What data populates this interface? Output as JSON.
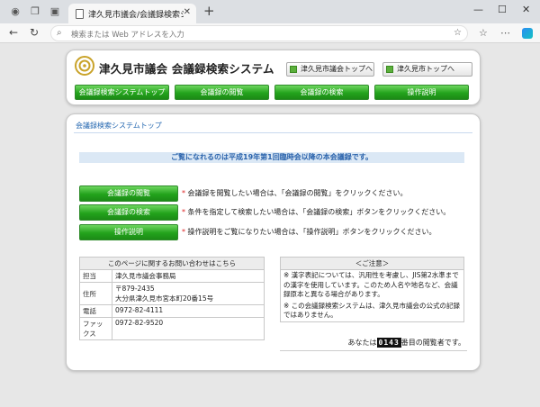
{
  "browser": {
    "tab_title": "津久見市議会/会議録検索システム",
    "address_placeholder": "検索または Web アドレスを入力"
  },
  "header": {
    "site_title": "津久見市議会 会議録検索システム",
    "links": [
      "津久見市議会トップへ",
      "津久見市トップへ"
    ],
    "nav": [
      "会議録検索システムトップ",
      "会議録の閲覧",
      "会議録の検索",
      "操作説明"
    ]
  },
  "main": {
    "section_title": "会議録検索システムトップ",
    "notice": "ご覧になれるのは平成19年第1回臨時会以降の本会議録です。",
    "actions": [
      {
        "label": "会議録の閲覧",
        "desc": "会議録を閲覧したい場合は、「会議録の閲覧」をクリックください。"
      },
      {
        "label": "会議録の検索",
        "desc": "条件を指定して検索したい場合は、「会議録の検索」ボタンをクリックください。"
      },
      {
        "label": "操作説明",
        "desc": "操作説明をご覧になりたい場合は、「操作説明」ボタンをクリックください。"
      }
    ],
    "asterisk": "*",
    "contact": {
      "heading": "このページに関するお問い合わせはこちら",
      "rows": [
        {
          "key": "担当",
          "value": "津久見市議会事務局"
        },
        {
          "key": "住所",
          "value": "〒879-2435",
          "value2": "大分県津久見市宮本町20番15号"
        },
        {
          "key": "電話",
          "value": "0972-82-4111"
        },
        {
          "key": "ファックス",
          "value": "0972-82-9520"
        }
      ]
    },
    "caution": {
      "heading": "＜ご注意＞",
      "lines": [
        "※ 漢字表記については、汎用性を考慮し、JIS第2水準までの漢字を使用しています。このため人名や地名など、会議録原本と異なる場合があります。",
        "※ この会議録検索システムは、津久見市議会の公式の記録ではありません。"
      ]
    },
    "counter": {
      "prefix": "あなたは",
      "value": "0143",
      "suffix": "番目の閲覧者です。"
    }
  }
}
